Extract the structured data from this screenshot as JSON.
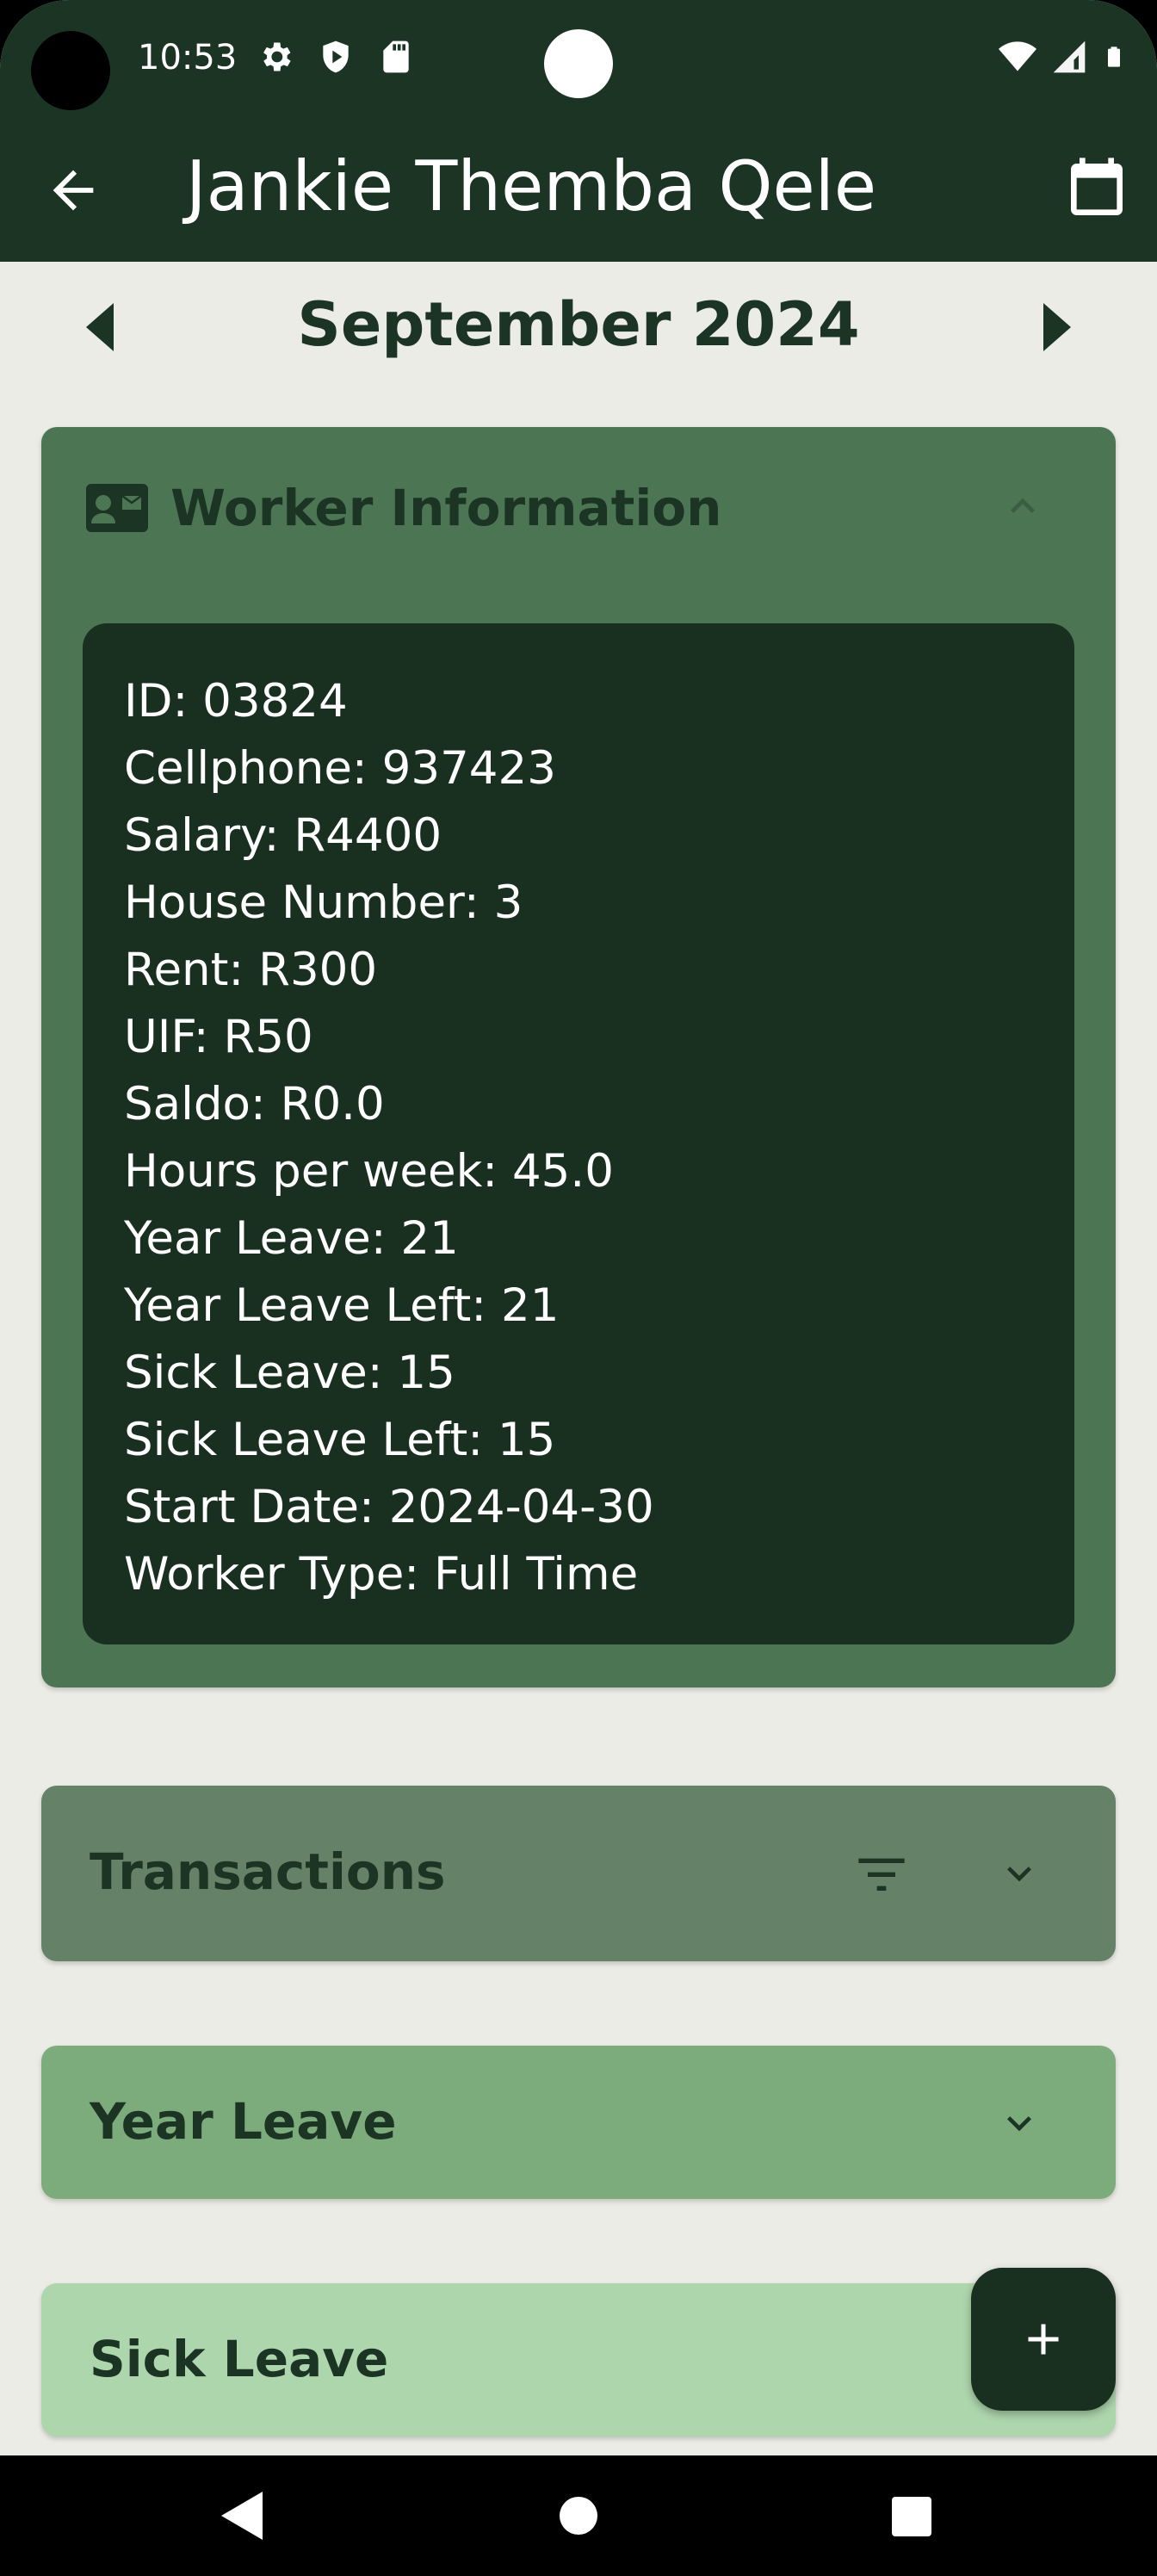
{
  "status_bar": {
    "time": "10:53"
  },
  "app_bar": {
    "title": "Jankie Themba Qele"
  },
  "month_nav": {
    "label": "September 2024"
  },
  "worker_info": {
    "title": "Worker Information",
    "fields": [
      "ID: 03824",
      "Cellphone: 937423",
      "Salary: R4400",
      "House Number: 3",
      "Rent: R300",
      "UIF: R50",
      "Saldo: R0.0",
      "Hours per week: 45.0",
      "Year Leave: 21",
      "Year Leave Left: 21",
      "Sick Leave: 15",
      "Sick Leave Left: 15",
      "Start Date: 2024-04-30",
      "Worker Type: Full Time"
    ]
  },
  "sections": {
    "transactions": "Transactions",
    "year_leave": "Year Leave",
    "sick_leave": "Sick Leave"
  },
  "colors": {
    "app_bar": "#1b3424",
    "background": "#ecece6",
    "worker_card": "#4c7653",
    "info_box": "#193021",
    "transactions_card": "#658268",
    "year_leave_card": "#7cac7b",
    "sick_leave_card": "#aed6ad",
    "fab": "#193021"
  },
  "icons": {
    "back": "arrow-left-icon",
    "calendar": "calendar-icon",
    "prev_month": "caret-left-icon",
    "next_month": "caret-right-icon",
    "worker_card": "contact-card-icon",
    "collapse": "chevron-up-icon",
    "expand": "chevron-down-icon",
    "filter": "filter-icon",
    "add": "plus-icon"
  }
}
